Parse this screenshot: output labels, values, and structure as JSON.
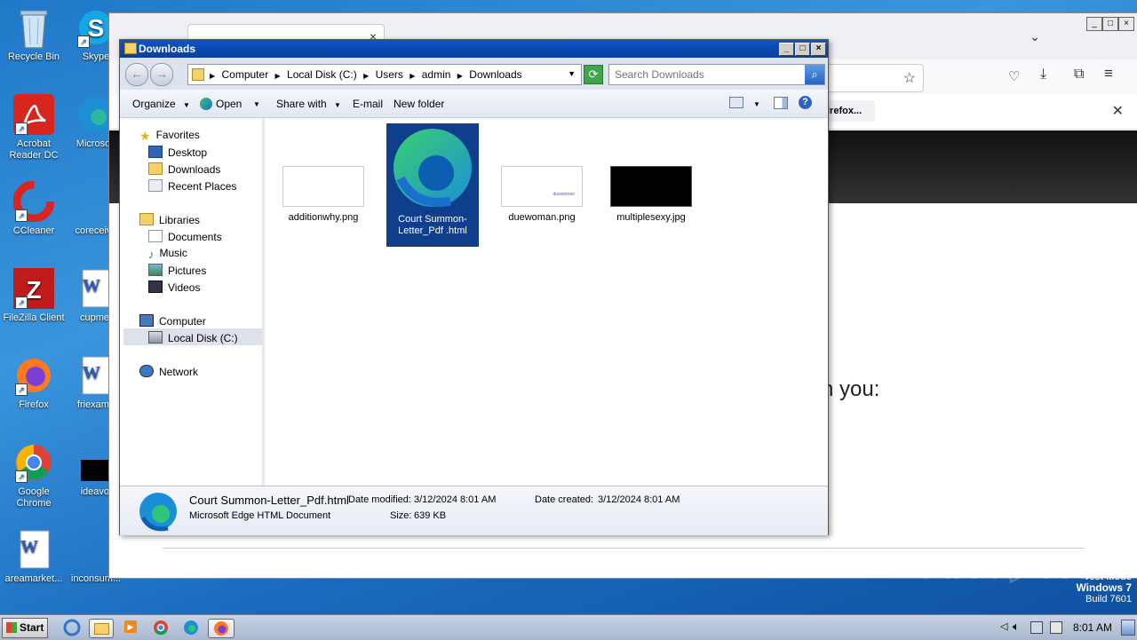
{
  "desktop": {
    "icons": [
      {
        "label": "Recycle Bin"
      },
      {
        "label": "Skype"
      },
      {
        "label": "Acrobat Reader DC"
      },
      {
        "label": "Microsoft"
      },
      {
        "label": "CCleaner"
      },
      {
        "label": "coreceive"
      },
      {
        "label": "FileZilla Client"
      },
      {
        "label": "cupmet"
      },
      {
        "label": "Firefox"
      },
      {
        "label": "friexamp"
      },
      {
        "label": "Google Chrome"
      },
      {
        "label": "ideavol"
      },
      {
        "label": "areamarket..."
      },
      {
        "label": "inconsum..."
      }
    ]
  },
  "browser": {
    "tab_close": "×",
    "notification_text": "irefox...",
    "page_text": "h you:",
    "win_controls": [
      "_",
      "□",
      "×"
    ]
  },
  "explorer": {
    "title": "Downloads",
    "title_controls": [
      "_",
      "□",
      "×"
    ],
    "breadcrumb": [
      "Computer",
      "Local Disk (C:)",
      "Users",
      "admin",
      "Downloads"
    ],
    "search_placeholder": "Search Downloads",
    "toolbar": {
      "organize": "Organize",
      "open": "Open",
      "share_with": "Share with",
      "email": "E-mail",
      "new_folder": "New folder"
    },
    "nav": {
      "favorites": "Favorites",
      "desktop": "Desktop",
      "downloads": "Downloads",
      "recent_places": "Recent Places",
      "libraries": "Libraries",
      "documents": "Documents",
      "music": "Music",
      "pictures": "Pictures",
      "videos": "Videos",
      "computer": "Computer",
      "local_disk": "Local Disk (C:)",
      "network": "Network"
    },
    "files": [
      {
        "name": "additionwhy.png",
        "thumb": "white"
      },
      {
        "name": "Court Summon-Letter_Pdf .html",
        "thumb": "edge",
        "selected": true
      },
      {
        "name": "duewoman.png",
        "thumb": "white-text",
        "thumb_text": "duewoman"
      },
      {
        "name": "multiplesexy.jpg",
        "thumb": "black"
      }
    ],
    "details": {
      "filename": "Court Summon-Letter_Pdf.html",
      "modified_label": "Date modified:",
      "modified_value": "3/12/2024 8:01 AM",
      "created_label": "Date created:",
      "created_value": "3/12/2024 8:01 AM",
      "type": "Microsoft Edge HTML Document",
      "size_label": "Size:",
      "size_value": "639 KB"
    }
  },
  "taskbar": {
    "start_label": "Start",
    "clock": "8:01 AM"
  },
  "watermark": {
    "line1": "Test Mode",
    "line2": "Windows 7",
    "line3": "Build 7601"
  },
  "colors": {
    "titlebar": "#0b56c8",
    "selection": "#0f3f8c",
    "desktop": "#1f78c8"
  }
}
